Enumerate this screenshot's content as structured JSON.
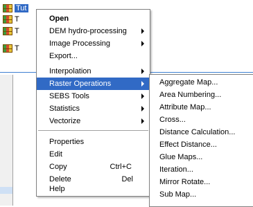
{
  "tree": {
    "items": [
      {
        "label": "T"
      },
      {
        "label": "T"
      },
      {
        "label": "T"
      },
      {
        "label": "T"
      }
    ],
    "selected_label": "Tut"
  },
  "context_menu": {
    "items": [
      {
        "label": "Open"
      },
      {
        "label": "DEM hydro-processing"
      },
      {
        "label": "Image Processing"
      },
      {
        "label": "Export..."
      },
      {
        "label": "Interpolation"
      },
      {
        "label": "Raster Operations"
      },
      {
        "label": "SEBS Tools"
      },
      {
        "label": "Statistics"
      },
      {
        "label": "Vectorize"
      },
      {
        "label": "Properties"
      },
      {
        "label": "Edit"
      },
      {
        "label": "Copy",
        "shortcut": "Ctrl+C"
      },
      {
        "label": "Delete",
        "shortcut": "Del"
      },
      {
        "label": "Help"
      }
    ],
    "highlight_color": "#316ac5"
  },
  "raster_submenu": {
    "items": [
      {
        "label": "Aggregate Map..."
      },
      {
        "label": "Area Numbering..."
      },
      {
        "label": "Attribute Map..."
      },
      {
        "label": "Cross..."
      },
      {
        "label": "Distance Calculation..."
      },
      {
        "label": "Effect Distance..."
      },
      {
        "label": "Glue Maps..."
      },
      {
        "label": "Iteration..."
      },
      {
        "label": "Mirror Rotate..."
      },
      {
        "label": "Sub Map..."
      }
    ]
  }
}
